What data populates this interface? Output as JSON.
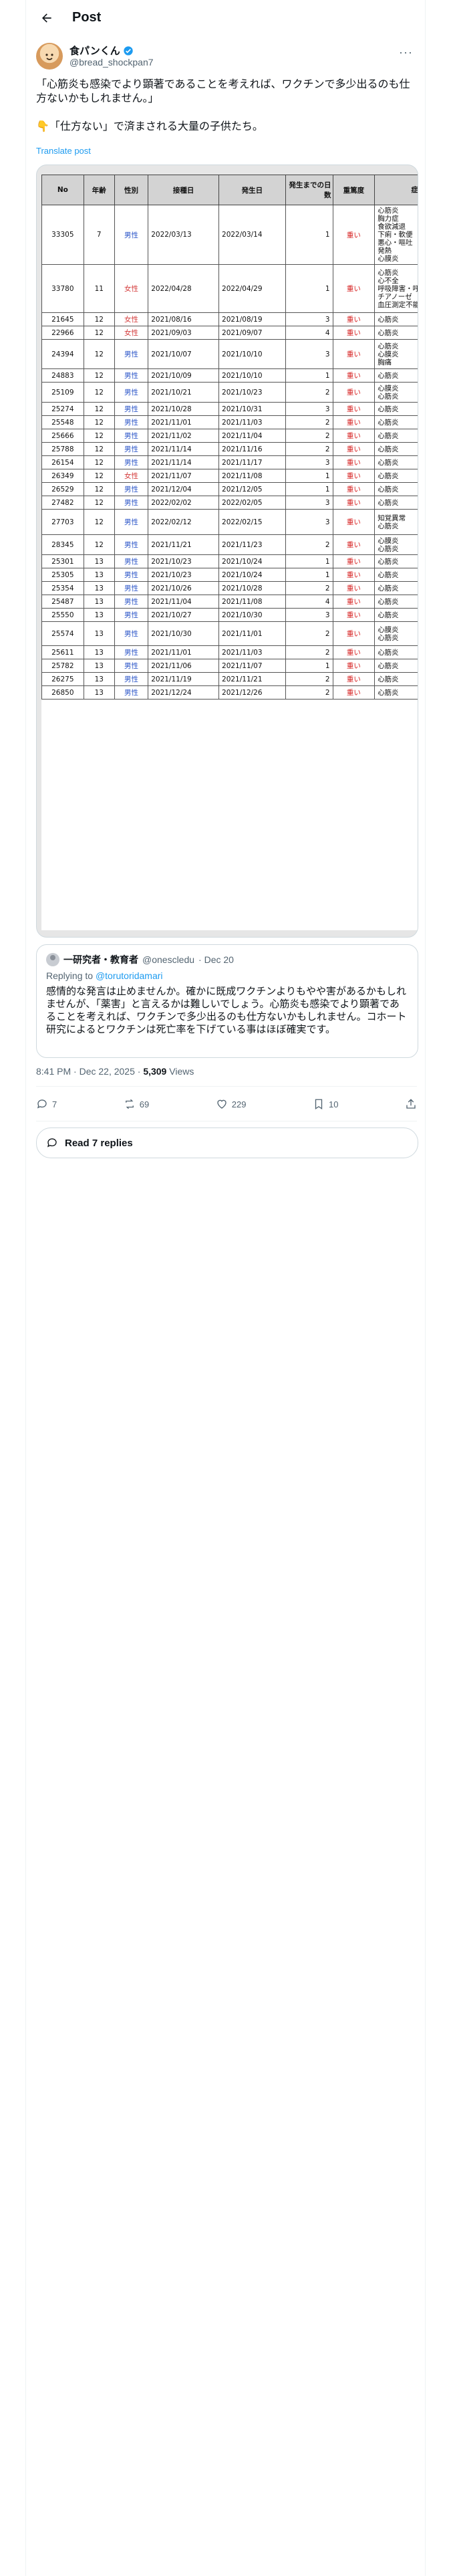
{
  "header": {
    "title": "Post"
  },
  "author": {
    "name": "食パンくん",
    "handle": "@bread_shockpan7"
  },
  "post": {
    "text_line1": "「心筋炎も感染でより顕著であることを考えれば、ワクチンで多少出るのも仕方ないかもしれません。」",
    "text_line2": "👇「仕方ない」で済まされる大量の子供たち。",
    "translate": "Translate post"
  },
  "table": {
    "headers": [
      "No",
      "年齢",
      "性別",
      "接種日",
      "発生日",
      "発生までの日数",
      "重篤度",
      "症状名"
    ],
    "rows": [
      {
        "no": "33305",
        "age": "7",
        "sex": "男性",
        "d1": "2022/03/13",
        "d2": "2022/03/14",
        "days": "1",
        "sev": "重い",
        "sym": "心筋炎\n胸力症\n食欲減退\n下痢・軟便\n悪心・嘔吐\n発熱\n心膜炎",
        "h": 88
      },
      {
        "no": "33780",
        "age": "11",
        "sex": "女性",
        "d1": "2022/04/28",
        "d2": "2022/04/29",
        "days": "1",
        "sev": "重い",
        "sym": "心筋炎\n心不全\n呼吸障害・呼吸不全\nチアノーゼ\n血圧測定不能",
        "h": 72
      },
      {
        "no": "21645",
        "age": "12",
        "sex": "女性",
        "d1": "2021/08/16",
        "d2": "2021/08/19",
        "days": "3",
        "sev": "重い",
        "sym": "心筋炎",
        "h": 18
      },
      {
        "no": "22966",
        "age": "12",
        "sex": "女性",
        "d1": "2021/09/03",
        "d2": "2021/09/07",
        "days": "4",
        "sev": "重い",
        "sym": "心筋炎",
        "h": 18
      },
      {
        "no": "24394",
        "age": "12",
        "sex": "男性",
        "d1": "2021/10/07",
        "d2": "2021/10/10",
        "days": "3",
        "sev": "重い",
        "sym": "心筋炎\n心膜炎\n胸痛",
        "h": 44
      },
      {
        "no": "24883",
        "age": "12",
        "sex": "男性",
        "d1": "2021/10/09",
        "d2": "2021/10/10",
        "days": "1",
        "sev": "重い",
        "sym": "心筋炎",
        "h": 18
      },
      {
        "no": "25109",
        "age": "12",
        "sex": "男性",
        "d1": "2021/10/21",
        "d2": "2021/10/23",
        "days": "2",
        "sev": "重い",
        "sym": "心膜炎\n心筋炎",
        "h": 30
      },
      {
        "no": "25274",
        "age": "12",
        "sex": "男性",
        "d1": "2021/10/28",
        "d2": "2021/10/31",
        "days": "3",
        "sev": "重い",
        "sym": "心筋炎",
        "h": 18
      },
      {
        "no": "25548",
        "age": "12",
        "sex": "男性",
        "d1": "2021/11/01",
        "d2": "2021/11/03",
        "days": "2",
        "sev": "重い",
        "sym": "心筋炎",
        "h": 18
      },
      {
        "no": "25666",
        "age": "12",
        "sex": "男性",
        "d1": "2021/11/02",
        "d2": "2021/11/04",
        "days": "2",
        "sev": "重い",
        "sym": "心筋炎",
        "h": 18
      },
      {
        "no": "25788",
        "age": "12",
        "sex": "男性",
        "d1": "2021/11/14",
        "d2": "2021/11/16",
        "days": "2",
        "sev": "重い",
        "sym": "心筋炎",
        "h": 18
      },
      {
        "no": "26154",
        "age": "12",
        "sex": "男性",
        "d1": "2021/11/14",
        "d2": "2021/11/17",
        "days": "3",
        "sev": "重い",
        "sym": "心筋炎",
        "h": 18
      },
      {
        "no": "26349",
        "age": "12",
        "sex": "女性",
        "d1": "2021/11/07",
        "d2": "2021/11/08",
        "days": "1",
        "sev": "重い",
        "sym": "心筋炎",
        "h": 18
      },
      {
        "no": "26529",
        "age": "12",
        "sex": "男性",
        "d1": "2021/12/04",
        "d2": "2021/12/05",
        "days": "1",
        "sev": "重い",
        "sym": "心筋炎",
        "h": 18
      },
      {
        "no": "27482",
        "age": "12",
        "sex": "男性",
        "d1": "2022/02/02",
        "d2": "2022/02/05",
        "days": "3",
        "sev": "重い",
        "sym": "心筋炎",
        "h": 18
      },
      {
        "no": "27703",
        "age": "12",
        "sex": "男性",
        "d1": "2022/02/12",
        "d2": "2022/02/15",
        "days": "3",
        "sev": "重い",
        "sym": "知覚異常\n心筋炎",
        "h": 38
      },
      {
        "no": "28345",
        "age": "12",
        "sex": "男性",
        "d1": "2021/11/21",
        "d2": "2021/11/23",
        "days": "2",
        "sev": "重い",
        "sym": "心膜炎\n心筋炎",
        "h": 30
      },
      {
        "no": "25301",
        "age": "13",
        "sex": "男性",
        "d1": "2021/10/23",
        "d2": "2021/10/24",
        "days": "1",
        "sev": "重い",
        "sym": "心筋炎",
        "h": 18
      },
      {
        "no": "25305",
        "age": "13",
        "sex": "男性",
        "d1": "2021/10/23",
        "d2": "2021/10/24",
        "days": "1",
        "sev": "重い",
        "sym": "心筋炎",
        "h": 18
      },
      {
        "no": "25354",
        "age": "13",
        "sex": "男性",
        "d1": "2021/10/26",
        "d2": "2021/10/28",
        "days": "2",
        "sev": "重い",
        "sym": "心筋炎",
        "h": 18
      },
      {
        "no": "25487",
        "age": "13",
        "sex": "男性",
        "d1": "2021/11/04",
        "d2": "2021/11/08",
        "days": "4",
        "sev": "重い",
        "sym": "心筋炎",
        "h": 18
      },
      {
        "no": "25550",
        "age": "13",
        "sex": "男性",
        "d1": "2021/10/27",
        "d2": "2021/10/30",
        "days": "3",
        "sev": "重い",
        "sym": "心筋炎",
        "h": 18
      },
      {
        "no": "25574",
        "age": "13",
        "sex": "男性",
        "d1": "2021/10/30",
        "d2": "2021/11/01",
        "days": "2",
        "sev": "重い",
        "sym": "心膜炎\n心筋炎",
        "h": 36
      },
      {
        "no": "25611",
        "age": "13",
        "sex": "男性",
        "d1": "2021/11/01",
        "d2": "2021/11/03",
        "days": "2",
        "sev": "重い",
        "sym": "心筋炎",
        "h": 18
      },
      {
        "no": "25782",
        "age": "13",
        "sex": "男性",
        "d1": "2021/11/06",
        "d2": "2021/11/07",
        "days": "1",
        "sev": "重い",
        "sym": "心筋炎",
        "h": 18
      },
      {
        "no": "26275",
        "age": "13",
        "sex": "男性",
        "d1": "2021/11/19",
        "d2": "2021/11/21",
        "days": "2",
        "sev": "重い",
        "sym": "心筋炎",
        "h": 18
      },
      {
        "no": "26850",
        "age": "13",
        "sex": "男性",
        "d1": "2021/12/24",
        "d2": "2021/12/26",
        "days": "2",
        "sev": "重い",
        "sym": "心筋炎",
        "h": 18
      }
    ]
  },
  "quote": {
    "name": "一研究者・教育者",
    "handle": "@onescledu",
    "date": "· Dec 20",
    "replying_prefix": "Replying to",
    "replying_to": "@torutoridamari",
    "text": "感情的な発言は止めませんか。確かに既成ワクチンよりもやや害があるかもしれませんが、「薬害」と言えるかは難しいでしょう。心筋炎も感染でより顕著であることを考えれば、ワクチンで多少出るのも仕方ないかもしれません。コホート研究によるとワクチンは死亡率を下げている事はほぼ確実です。"
  },
  "meta": {
    "time": "8:41 PM · Dec 22, 2025 · ",
    "views": "5,309",
    "views_label": " Views"
  },
  "actions": {
    "replies": "7",
    "reposts": "69",
    "likes": "229",
    "bookmarks": "10"
  },
  "read_replies": "Read 7 replies",
  "colors": {
    "male": "#2b55c8",
    "female": "#d43b3b",
    "severity": "#d61f1f",
    "link": "#1d9bf0"
  }
}
